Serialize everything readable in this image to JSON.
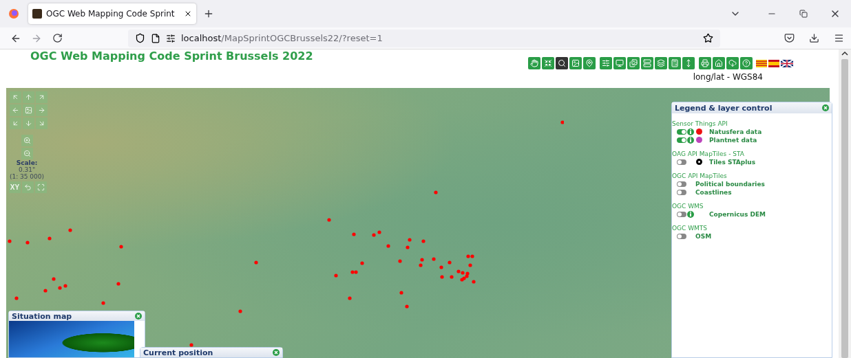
{
  "browser": {
    "tab_title": "OGC Web Mapping Code Sprint",
    "url_host": "localhost",
    "url_path": "/MapSprintOGCBrussels22/?reset=1"
  },
  "page_title": "OGC Web Mapping Code Sprint Brussels 2022",
  "toolbar": {
    "buttons": [
      {
        "selected": false
      },
      {
        "selected": false
      },
      {
        "selected": true
      },
      {
        "selected": false
      },
      {
        "selected": false
      },
      {
        "selected": false
      },
      {
        "selected": false
      },
      {
        "selected": false
      },
      {
        "selected": false
      },
      {
        "selected": false
      },
      {
        "selected": false
      },
      {
        "selected": false
      },
      {
        "selected": false
      },
      {
        "selected": false
      },
      {
        "selected": false
      },
      {
        "selected": false
      }
    ]
  },
  "crs_label": "long/lat - WGS84",
  "map_controls": {
    "scale_label": "Scale:",
    "scale_value": "0.31\"",
    "scale_ratio": "(1: 35 000)",
    "coords_button": "XY"
  },
  "legend": {
    "title": "Legend & layer control",
    "groups": [
      {
        "title": "Sensor Things API",
        "layers": [
          {
            "name": "Natusfera data",
            "on": true,
            "info": true,
            "symbol": {
              "kind": "dot",
              "color": "#ee1111"
            }
          },
          {
            "name": "Plantnet data",
            "on": true,
            "info": true,
            "symbol": {
              "kind": "dot",
              "color": "#bb44bb"
            }
          }
        ]
      },
      {
        "title": "OAG API MapTiles - STA",
        "layers": [
          {
            "name": "Tiles STAplus",
            "on": false,
            "info": false,
            "symbol": {
              "kind": "ring",
              "color": "#000000"
            }
          }
        ]
      },
      {
        "title": "OGC API MapTiles",
        "layers": [
          {
            "name": "Political boundaries",
            "on": false,
            "info": false
          },
          {
            "name": "Coastlines",
            "on": false,
            "info": false
          }
        ]
      },
      {
        "title": "OGC WMS",
        "layers": [
          {
            "name": "Copernicus DEM",
            "on": false,
            "info": true
          }
        ]
      },
      {
        "title": "OGC WMTS",
        "layers": [
          {
            "name": "OSM",
            "on": false,
            "info": false
          }
        ]
      }
    ]
  },
  "situation_map": {
    "title": "Situation map"
  },
  "current_position": {
    "title": "Current position"
  }
}
